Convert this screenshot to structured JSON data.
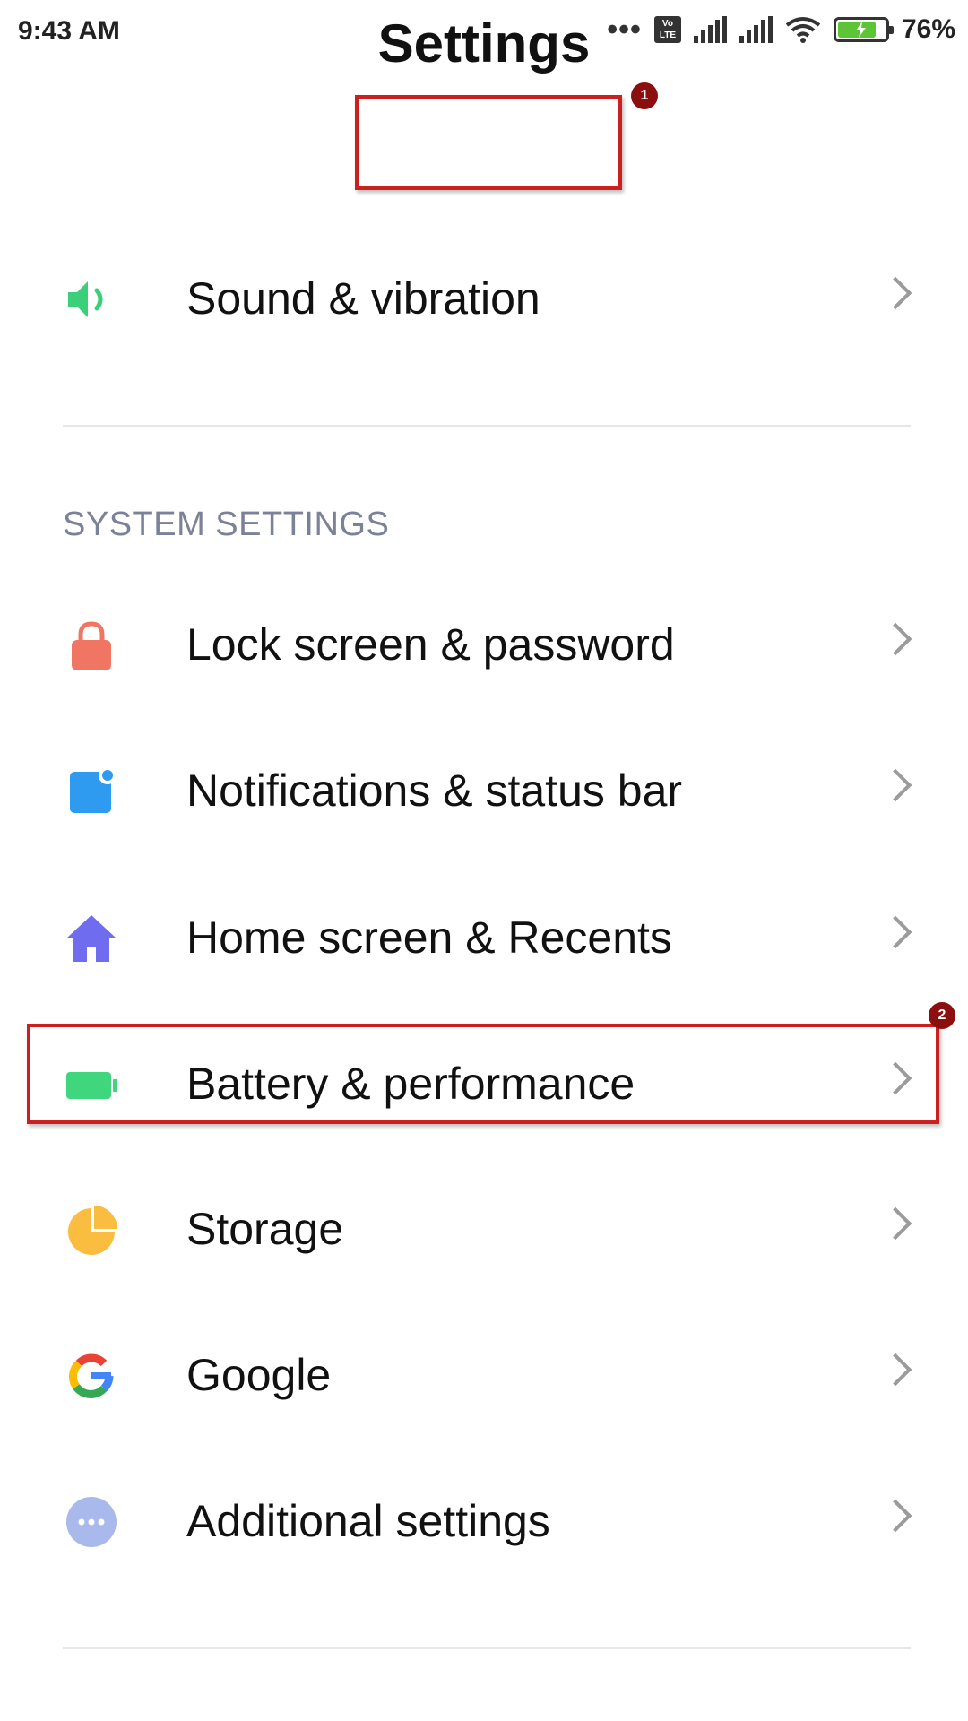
{
  "status_bar": {
    "time": "9:43 AM",
    "more_glyph": "•••",
    "volte_label": "Vo\nLTE",
    "battery_percent": "76%",
    "battery_level": 0.76,
    "icons": [
      "more-dots-icon",
      "volte-icon",
      "signal-icon",
      "signal-icon",
      "wifi-icon",
      "battery-charging-icon"
    ]
  },
  "header": {
    "title": "Settings",
    "annotation_1": "1"
  },
  "items": [
    {
      "label": "Sound & vibration",
      "icon": "speaker-icon",
      "color": "#3ccf7a"
    },
    {
      "label": "Lock screen & password",
      "icon": "lock-icon",
      "color": "#f07562"
    },
    {
      "label": "Notifications & status bar",
      "icon": "notification-icon",
      "color": "#2f9bf0"
    },
    {
      "label": "Home screen & Recents",
      "icon": "home-icon",
      "color": "#6f6cf0"
    },
    {
      "label": "Battery & performance",
      "icon": "battery-icon",
      "color": "#3fd67e"
    },
    {
      "label": "Storage",
      "icon": "pie-chart-icon",
      "color": "#fbbd40"
    },
    {
      "label": "Google",
      "icon": "google-icon",
      "color": "#4285f4"
    },
    {
      "label": "Additional settings",
      "icon": "more-icon",
      "color": "#a9b9ec"
    }
  ],
  "section": {
    "system_settings": "SYSTEM SETTINGS"
  },
  "annotations": {
    "badge_2": "2"
  },
  "colors": {
    "highlight": "#cc1f1f",
    "badge": "#8b0f0f",
    "section_text": "#7b8298"
  }
}
